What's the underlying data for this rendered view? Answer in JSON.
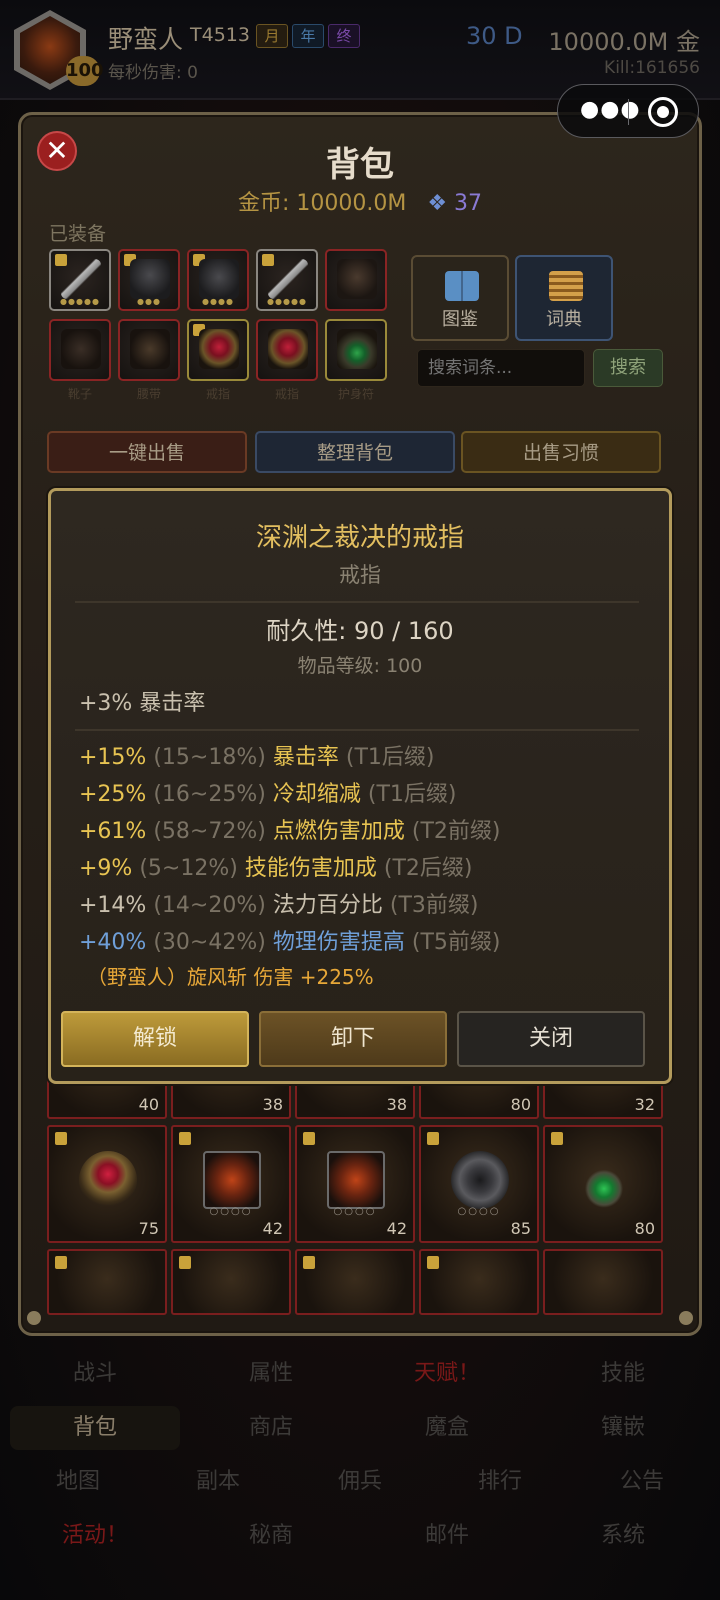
{
  "header": {
    "avatar_level": "100",
    "player_name": "野蛮人",
    "tier": "T4513",
    "badges": [
      "月",
      "年",
      "终"
    ],
    "dps_label": "每秒伤害: 0",
    "days": "30 D",
    "gold": "10000.0M 金",
    "kills": "Kill:161656"
  },
  "bag": {
    "title": "背包",
    "gold_label": "金币: 10000.0M",
    "gems": "37",
    "equipped_label": "已装备",
    "slot_labels": [
      "靴子",
      "腰带",
      "戒指",
      "戒指",
      "护身符"
    ],
    "codex_button": "图鉴",
    "dictionary_button": "词典",
    "search_placeholder": "搜索词条...",
    "search_button": "搜索",
    "one_click_sell": "一键出售",
    "sort_bag": "整理背包",
    "sell_habit": "出售习惯",
    "grid_levels_row1": [
      "40",
      "38",
      "38",
      "80",
      "32"
    ],
    "grid_levels_row2": [
      "75",
      "42",
      "42",
      "85",
      "80"
    ]
  },
  "tooltip": {
    "item_name": "深渊之裁决的戒指",
    "item_type": "戒指",
    "durability": "耐久性: 90 / 160",
    "item_level": "物品等级: 100",
    "implicit": "+3% 暴击率",
    "affixes": [
      {
        "value": "+15%",
        "range": "(15~18%)",
        "name": "暴击率",
        "tier": "(T1后缀)"
      },
      {
        "value": "+25%",
        "range": "(16~25%)",
        "name": "冷却缩减",
        "tier": "(T1后缀)"
      },
      {
        "value": "+61%",
        "range": "(58~72%)",
        "name": "点燃伤害加成",
        "tier": "(T2前缀)"
      },
      {
        "value": "+9%",
        "range": "(5~12%)",
        "name": "技能伤害加成",
        "tier": "(T2后缀)"
      },
      {
        "value": "+14%",
        "range": "(14~20%)",
        "name": "法力百分比",
        "tier": "(T3前缀)"
      },
      {
        "value": "+40%",
        "range": "(30~42%)",
        "name": "物理伤害提高",
        "tier": "(T5前缀)"
      }
    ],
    "skill_bonus": "（野蛮人）旋风斩 伤害 +225%",
    "unlock_button": "解锁",
    "unequip_button": "卸下",
    "close_button": "关闭"
  },
  "nav": {
    "row1": [
      "战斗",
      "属性",
      "天赋！",
      "技能"
    ],
    "row2": [
      "背包",
      "商店",
      "魔盒",
      "镶嵌"
    ],
    "row3": [
      "地图",
      "副本",
      "佣兵",
      "排行",
      "公告"
    ],
    "row4": [
      "活动！",
      "秘商",
      "邮件",
      "系统"
    ]
  },
  "colors": {
    "affix_gold": "#e8c452",
    "affix_blue": "#6f9fd8",
    "skill_orange": "#e8a838",
    "item_title": "#e3bf60"
  }
}
